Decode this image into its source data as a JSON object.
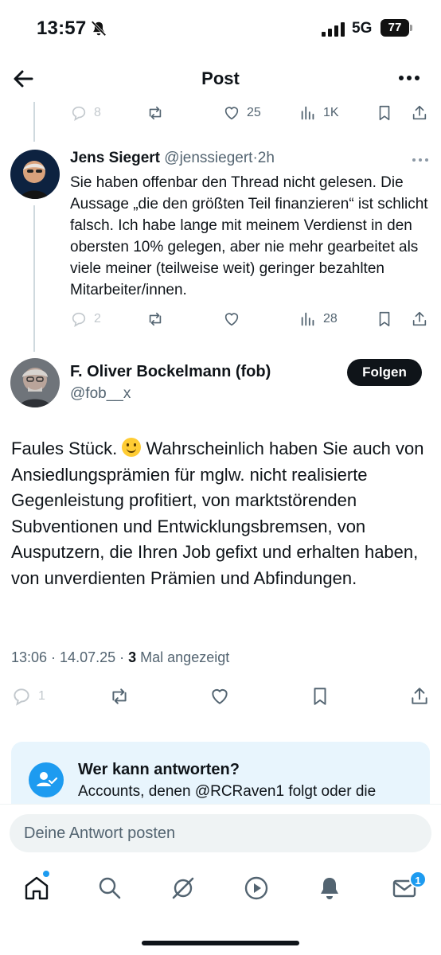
{
  "status_bar": {
    "time": "13:57",
    "network": "5G",
    "battery": "77"
  },
  "nav": {
    "title": "Post",
    "back_icon": "arrow-left-icon",
    "more_icon": "more-horizontal-icon"
  },
  "parent_actions": {
    "reply_count": "8",
    "like_count": "25",
    "view_count": "1K"
  },
  "reply": {
    "author_name": "Jens Siegert",
    "author_handle": "@jenssiegert",
    "separator": "·",
    "time": "2h",
    "text": "Sie haben offenbar den Thread nicht gelesen. Die Aussage „die den größten Teil finanzieren“ ist schlicht falsch. Ich habe lange mit meinem Verdienst in den obersten 10% gelegen, aber nie mehr gearbeitet als viele meiner (teilweise weit) geringer bezahlten Mitarbeiter/innen.",
    "reply_count": "2",
    "view_count": "28"
  },
  "main_post": {
    "author_name": "F. Oliver Bockelmann (fob)",
    "author_handle": "@fob__x",
    "follow_label": "Folgen",
    "text_before_emoji": "Faules Stück. ",
    "text_after_emoji": " Wahrscheinlich haben Sie auch von Ansiedlungsprämien für mglw. nicht realisierte Gegenleistung profitiert, von marktstörenden Subventionen und Entwicklungsbremsen, von Ausputzern, die Ihren Job gefixt und erhalten haben, von unverdienten Prämien und Abfindungen.",
    "time": "13:06",
    "date": "14.07.25",
    "views": "3",
    "views_label": "Mal angezeigt",
    "reply_count": "1"
  },
  "who_can_reply": {
    "title": "Wer kann antworten?",
    "text": "Accounts, denen @RCRaven1 folgt oder die"
  },
  "compose": {
    "placeholder": "Deine Antwort posten"
  },
  "tabbar": {
    "messages_badge": "1"
  },
  "colors": {
    "accent": "#1d9bf0",
    "text": "#0f1419",
    "muted": "#536471",
    "card": "#e8f5fd"
  }
}
